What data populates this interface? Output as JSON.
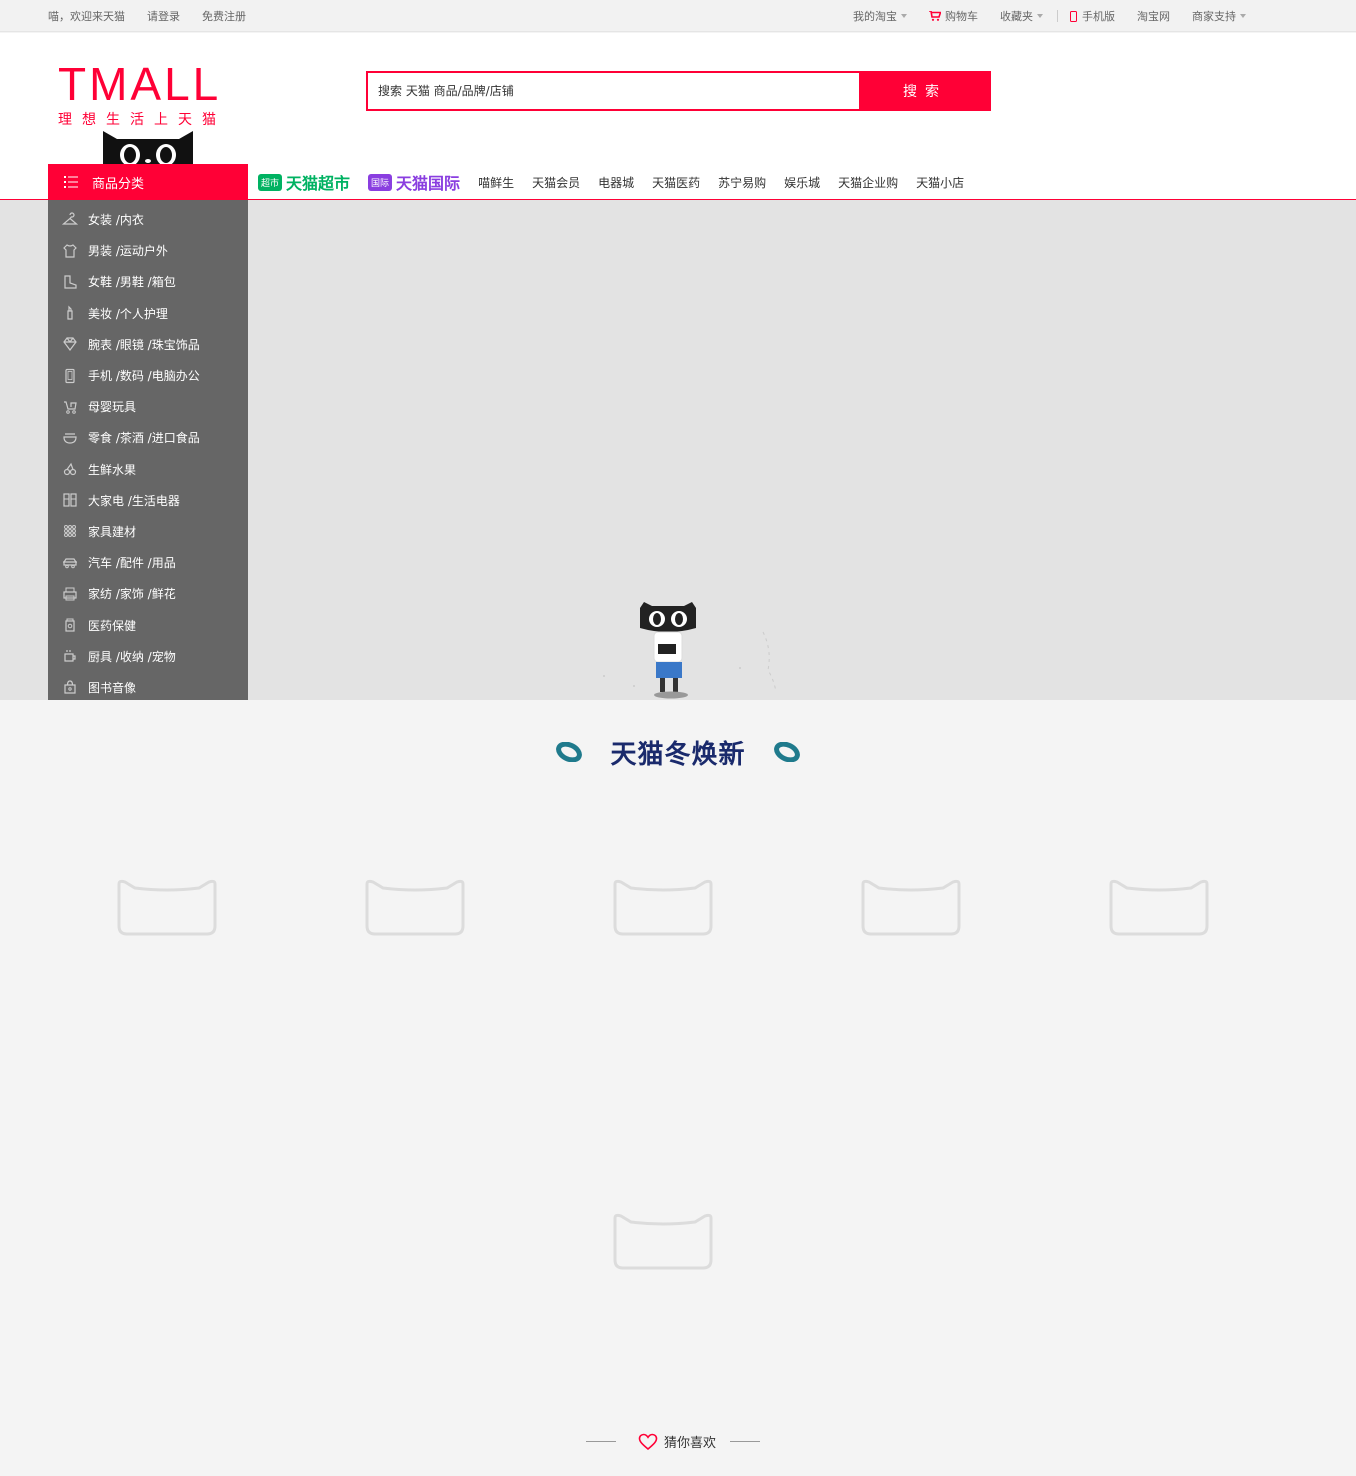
{
  "topbar": {
    "left_links": [
      "喵，欢迎来天猫",
      "请登录",
      "免费注册"
    ],
    "my_taobao": "我的淘宝",
    "cart": "购物车",
    "favorites": "收藏夹",
    "mobile": "手机版",
    "taobao": "淘宝网",
    "merchant": "商家支持"
  },
  "header": {
    "logo_text": "TMALL",
    "slogan": "理想生活上天猫",
    "search_placeholder": "搜索 天猫 商品/品牌/店铺",
    "search_button": "搜索"
  },
  "nav": {
    "category_button": "商品分类",
    "supermarket": {
      "tag": "超市",
      "label": "天猫超市"
    },
    "international": {
      "tag": "国际",
      "label": "天猫国际"
    },
    "links": [
      "喵鲜生",
      "天猫会员",
      "电器城",
      "天猫医药",
      "苏宁易购",
      "娱乐城",
      "天猫企业购",
      "天猫小店"
    ]
  },
  "categories": [
    {
      "label": "女装 /内衣",
      "icon": "hanger-icon"
    },
    {
      "label": "男装 /运动户外",
      "icon": "tshirt-icon"
    },
    {
      "label": "女鞋 /男鞋 /箱包",
      "icon": "boot-icon"
    },
    {
      "label": "美妆 /个人护理",
      "icon": "lipstick-icon"
    },
    {
      "label": "腕表 /眼镜 /珠宝饰品",
      "icon": "diamond-icon"
    },
    {
      "label": "手机 /数码 /电脑办公",
      "icon": "phone-icon"
    },
    {
      "label": "母婴玩具",
      "icon": "stroller-icon"
    },
    {
      "label": "零食 /茶酒 /进口食品",
      "icon": "bowl-icon"
    },
    {
      "label": "生鲜水果",
      "icon": "cherry-icon"
    },
    {
      "label": "大家电 /生活电器",
      "icon": "fridge-icon"
    },
    {
      "label": "家具建材",
      "icon": "grid-icon"
    },
    {
      "label": "汽车 /配件 /用品",
      "icon": "car-icon"
    },
    {
      "label": "家纺 /家饰 /鲜花",
      "icon": "printer-icon"
    },
    {
      "label": "医药保健",
      "icon": "medicine-icon"
    },
    {
      "label": "厨具 /收纳 /宠物",
      "icon": "cup-icon"
    },
    {
      "label": "图书音像",
      "icon": "bag-icon"
    }
  ],
  "section": {
    "title": "天猫冬焕新"
  },
  "guess": {
    "label": "猜你喜欢"
  },
  "colors": {
    "brand": "#ff0036",
    "sidebar": "#666666",
    "title": "#1a2a6c"
  }
}
